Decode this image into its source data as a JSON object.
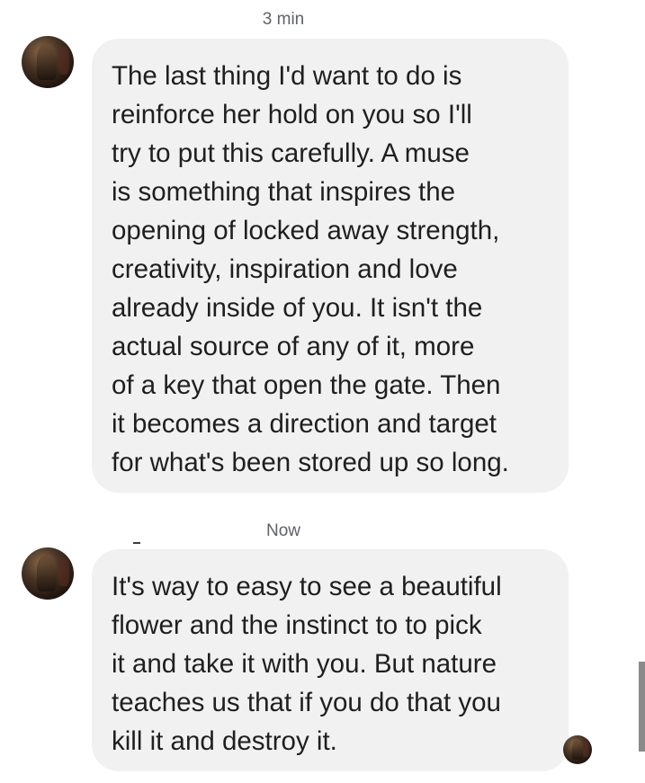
{
  "conversation": {
    "messages": [
      {
        "timestamp": "3 min",
        "sender_avatar": "contact-avatar",
        "text": "The last thing I'd want to do is\nreinforce her hold on you so I'll\ntry to put this carefully. A muse\nis something that inspires the\nopening of locked away strength,\ncreativity, inspiration and love\nalready inside of you. It isn't the\nactual source of any of it, more\nof a key that open the gate. Then\nit becomes a direction and target\nfor what's been stored up so long."
      },
      {
        "timestamp": "Now",
        "sender_avatar": "contact-avatar",
        "text": "It's way to easy to see a beautiful\nflower and the instinct to to pick\nit and take it with you. But nature\nteaches us that if you do that you\nkill it and destroy it."
      }
    ],
    "read_receipt": "contact-avatar-small"
  },
  "colors": {
    "bubble_background": "#f1f1f1",
    "text": "#1f1f1f",
    "timestamp": "#5f6368",
    "page_background": "#ffffff"
  }
}
